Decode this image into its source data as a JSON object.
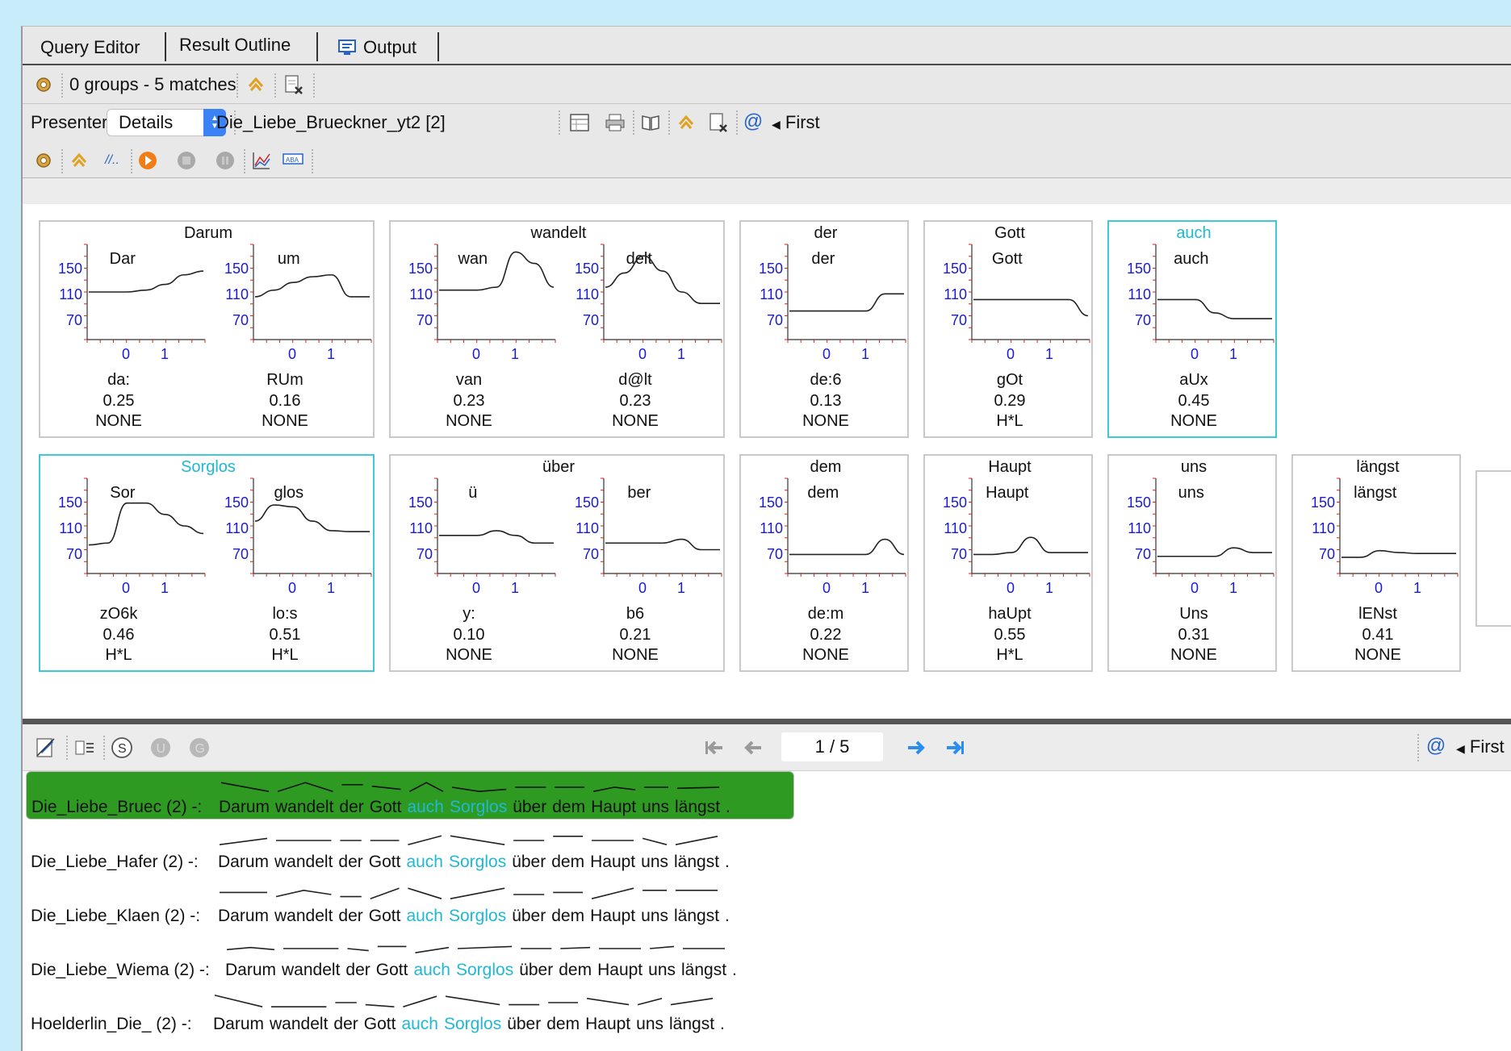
{
  "tabs": [
    {
      "label": "Query Editor"
    },
    {
      "label": "Result Outline"
    },
    {
      "label": "Output",
      "icon": "monitor-icon"
    }
  ],
  "summary": {
    "text": "0 groups - 5 matches"
  },
  "presenter": {
    "label": "Presenter",
    "value": "Details",
    "document": "Die_Liebe_Brueckner_yt2 [2]",
    "first": "First"
  },
  "y_ticks": [
    "150",
    "110",
    "70"
  ],
  "x_ticks": [
    "0",
    "1"
  ],
  "row1": [
    {
      "word": "Darum",
      "highlight": false,
      "syllables": [
        {
          "label": "Dar",
          "phon": "da:",
          "dur": "0.25",
          "tone": "NONE",
          "contour": [
            0.5,
            0.5,
            0.5,
            0.52,
            0.58,
            0.68,
            0.72
          ]
        },
        {
          "label": "um",
          "phon": "RUm",
          "dur": "0.16",
          "tone": "NONE",
          "contour": [
            0.45,
            0.52,
            0.6,
            0.66,
            0.68,
            0.45,
            0.45
          ]
        }
      ]
    },
    {
      "word": "wandelt",
      "highlight": false,
      "syllables": [
        {
          "label": "wan",
          "phon": "van",
          "dur": "0.23",
          "tone": "NONE",
          "contour": [
            0.52,
            0.52,
            0.52,
            0.55,
            0.92,
            0.8,
            0.55
          ]
        },
        {
          "label": "delt",
          "phon": "d@lt",
          "dur": "0.23",
          "tone": "NONE",
          "contour": [
            0.55,
            0.7,
            0.88,
            0.72,
            0.5,
            0.38,
            0.38
          ]
        }
      ]
    },
    {
      "word": "der",
      "highlight": false,
      "syllables": [
        {
          "label": "der",
          "phon": "de:6",
          "dur": "0.13",
          "tone": "NONE",
          "contour": [
            0.3,
            0.3,
            0.3,
            0.3,
            0.3,
            0.48,
            0.48
          ]
        }
      ]
    },
    {
      "word": "Gott",
      "highlight": false,
      "syllables": [
        {
          "label": "Gott",
          "phon": "gOt",
          "dur": "0.29",
          "tone": "H*L",
          "contour": [
            0.42,
            0.42,
            0.42,
            0.42,
            0.42,
            0.42,
            0.25
          ]
        }
      ]
    },
    {
      "word": "auch",
      "highlight": true,
      "syllables": [
        {
          "label": "auch",
          "phon": "aUx",
          "dur": "0.45",
          "tone": "NONE",
          "contour": [
            0.42,
            0.42,
            0.42,
            0.28,
            0.22,
            0.22,
            0.22
          ]
        }
      ]
    }
  ],
  "row2": [
    {
      "word": "Sorglos",
      "highlight": true,
      "syllables": [
        {
          "label": "Sor",
          "phon": "zO6k",
          "dur": "0.46",
          "tone": "H*L",
          "contour": [
            0.3,
            0.32,
            0.74,
            0.74,
            0.62,
            0.5,
            0.42
          ]
        },
        {
          "label": "glos",
          "phon": "lo:s",
          "dur": "0.51",
          "tone": "H*L",
          "contour": [
            0.55,
            0.72,
            0.7,
            0.55,
            0.45,
            0.44,
            0.44
          ]
        }
      ]
    },
    {
      "word": "über",
      "highlight": false,
      "syllables": [
        {
          "label": "ü",
          "phon": "y:",
          "dur": "0.10",
          "tone": "NONE",
          "contour": [
            0.4,
            0.4,
            0.4,
            0.45,
            0.4,
            0.32,
            0.32
          ]
        },
        {
          "label": "ber",
          "phon": "b6",
          "dur": "0.21",
          "tone": "NONE",
          "contour": [
            0.32,
            0.32,
            0.32,
            0.32,
            0.36,
            0.25,
            0.25
          ]
        }
      ]
    },
    {
      "word": "dem",
      "highlight": false,
      "syllables": [
        {
          "label": "dem",
          "phon": "de:m",
          "dur": "0.22",
          "tone": "NONE",
          "contour": [
            0.2,
            0.2,
            0.2,
            0.2,
            0.2,
            0.36,
            0.2
          ]
        }
      ]
    },
    {
      "word": "Haupt",
      "highlight": false,
      "syllables": [
        {
          "label": "Haupt",
          "phon": "haUpt",
          "dur": "0.55",
          "tone": "H*L",
          "contour": [
            0.2,
            0.2,
            0.22,
            0.38,
            0.22,
            0.22,
            0.22
          ]
        }
      ]
    },
    {
      "word": "uns",
      "highlight": false,
      "syllables": [
        {
          "label": "uns",
          "phon": "Uns",
          "dur": "0.31",
          "tone": "NONE",
          "contour": [
            0.18,
            0.18,
            0.18,
            0.18,
            0.27,
            0.22,
            0.22
          ]
        }
      ]
    },
    {
      "word": "längst",
      "highlight": false,
      "syllables": [
        {
          "label": "längst",
          "phon": "lENst",
          "dur": "0.41",
          "tone": "NONE",
          "contour": [
            0.17,
            0.17,
            0.24,
            0.22,
            0.21,
            0.21,
            0.21
          ]
        }
      ]
    }
  ],
  "pager": {
    "text": "1 / 5",
    "first": "First"
  },
  "kwic": [
    {
      "source": "Die_Liebe_Bruec (2) -:",
      "selected": true
    },
    {
      "source": "Die_Liebe_Hafer (2) -:",
      "selected": false
    },
    {
      "source": "Die_Liebe_Klaen (2) -:",
      "selected": false
    },
    {
      "source": "Die_Liebe_Wiema (2) -:",
      "selected": false
    },
    {
      "source": "Hoelderlin_Die_ (2) -:",
      "selected": false
    }
  ],
  "sentence": [
    "Darum",
    "wandelt",
    "der",
    "Gott",
    "auch",
    "Sorglos",
    "über",
    "dem",
    "Haupt",
    "uns",
    "längst",
    "."
  ],
  "keywords": [
    "auch",
    "Sorglos"
  ],
  "colors": {
    "accent": "#20b8d4",
    "selection": "#2f9a21",
    "axis": "#1a1ad6",
    "tick": "#d42020"
  }
}
